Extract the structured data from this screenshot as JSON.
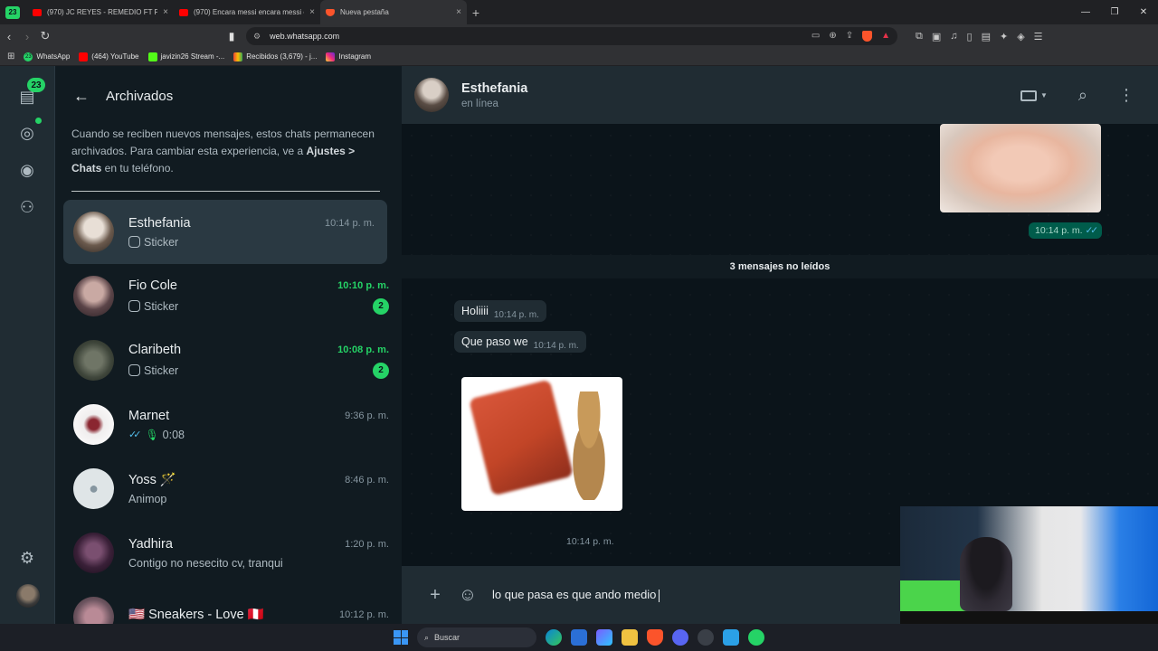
{
  "browser": {
    "tab_count": "23",
    "tabs": [
      {
        "label": "(970) JC REYES - REMEDIO FT PIRLO",
        "close": "×"
      },
      {
        "label": "(970) Encara messi encara messi enca",
        "close": "×"
      },
      {
        "label": "Nueva pestaña",
        "close": "×"
      }
    ],
    "new_tab": "+",
    "url": "web.whatsapp.com",
    "bookmarks": [
      {
        "label": "WhatsApp",
        "badge": "23"
      },
      {
        "label": "(464) YouTube"
      },
      {
        "label": "javizin26 Stream -..."
      },
      {
        "label": "Recibidos (3,679) - j..."
      },
      {
        "label": "Instagram"
      }
    ],
    "colors": {
      "brave": "#fb542b",
      "youtube": "#ff0000"
    }
  },
  "rail": {
    "chats_badge": "23",
    "icons": [
      "chats-icon",
      "status-icon",
      "channels-icon",
      "communities-icon",
      "settings-icon",
      "profile-avatar"
    ]
  },
  "sidebar": {
    "title": "Archivados",
    "info_prefix": "Cuando se reciben nuevos mensajes, estos chats permanecen archivados. Para cambiar esta experiencia, ve a ",
    "info_bold": "Ajustes > Chats",
    "info_suffix": " en tu teléfono.",
    "chats": [
      {
        "name": "Esthefania",
        "time": "10:14 p. m.",
        "preview": "Sticker",
        "unread": ""
      },
      {
        "name": "Fio Cole",
        "time": "10:10 p. m.",
        "preview": "Sticker",
        "unread": "2"
      },
      {
        "name": "Claribeth",
        "time": "10:08 p. m.",
        "preview": "Sticker",
        "unread": "2"
      },
      {
        "name": "Marnet",
        "time": "9:36 p. m.",
        "preview": "0:08",
        "unread": ""
      },
      {
        "name": "Yoss 🪄",
        "time": "8:46 p. m.",
        "preview": "Animop",
        "unread": ""
      },
      {
        "name": "Yadhira",
        "time": "1:20 p. m.",
        "preview": "Contigo no nesecito cv, tranqui",
        "unread": ""
      },
      {
        "name": "🇺🇸 Sneakers - Love 🇵🇪",
        "time": "10:12 p. m.",
        "preview": "",
        "unread": ""
      }
    ]
  },
  "chat": {
    "name": "Esthefania",
    "status": "en línea",
    "sent_image_time": "10:14 p. m.",
    "unread_banner": "3 mensajes no leídos",
    "messages": [
      {
        "text": "Holiiii",
        "time": "10:14 p. m."
      },
      {
        "text": "Que paso we",
        "time": "10:14 p. m."
      }
    ],
    "sticker_time": "10:14 p. m.",
    "composer_text": "lo que pasa es que ando medio",
    "accent": "#25d366",
    "outgoing_bubble": "#005c4b"
  },
  "taskbar": {
    "search_label": "Buscar"
  }
}
